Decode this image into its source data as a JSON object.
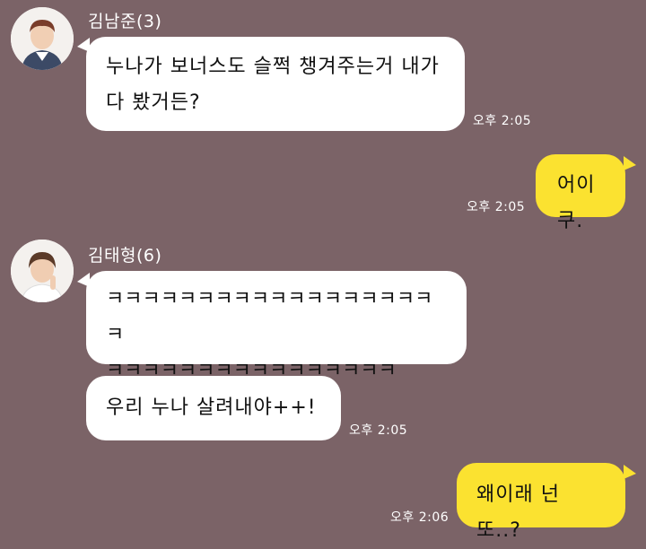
{
  "conversation": [
    {
      "sender": "김남준(3)",
      "avatar_icon": "profile-photo-icon",
      "messages": [
        {
          "line1": "누나가 보너스도 슬쩍 챙겨주는거 내가",
          "line2": "다 봤거든?",
          "time": "오후 2:05"
        }
      ]
    },
    {
      "sender": "me",
      "messages": [
        {
          "text": "어이쿠.",
          "time": "오후 2:05"
        }
      ]
    },
    {
      "sender": "김태형(6)",
      "avatar_icon": "profile-photo-icon",
      "messages": [
        {
          "line1": "ㅋㅋㅋㅋㅋㅋㅋㅋㅋㅋㅋㅋㅋㅋㅋㅋㅋㅋㅋ",
          "line2": "ㅋㅋㅋㅋㅋㅋㅋㅋㅋㅋㅋㅋㅋㅋㅋㅋ"
        },
        {
          "text": "우리 누나 살려내야++!",
          "time": "오후 2:05"
        }
      ]
    },
    {
      "sender": "me",
      "messages": [
        {
          "text": "왜이래 넌 또..?",
          "time": "오후 2:06"
        }
      ]
    }
  ],
  "colors": {
    "background": "#7b6367",
    "incoming_bubble": "#ffffff",
    "outgoing_bubble": "#fbe230"
  }
}
